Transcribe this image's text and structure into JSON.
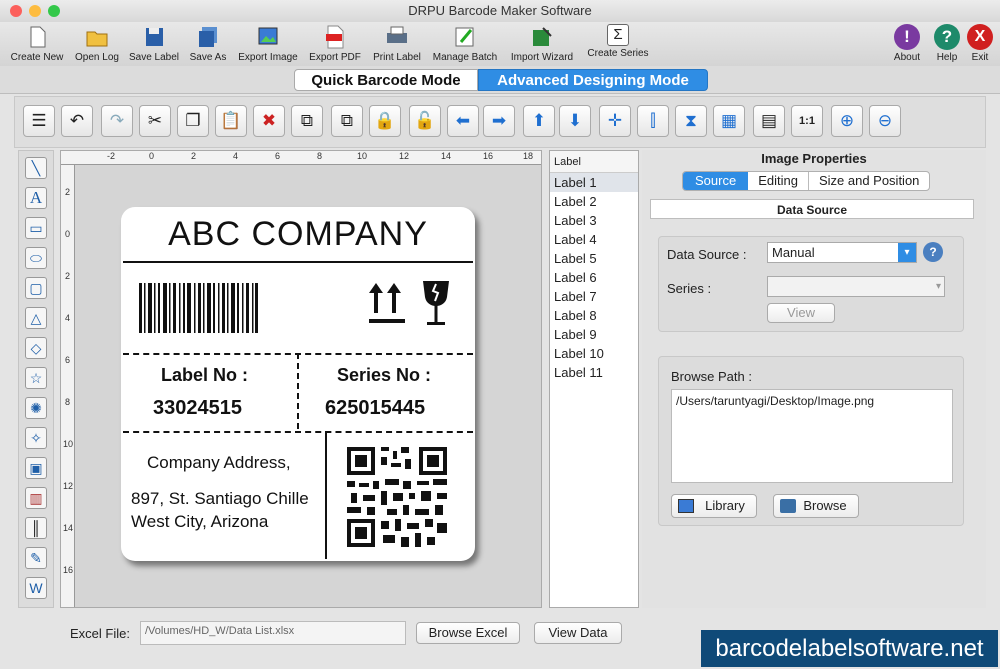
{
  "window": {
    "title": "DRPU Barcode Maker Software"
  },
  "toolbar": {
    "items": [
      {
        "label": "Create New",
        "icon": "document-icon"
      },
      {
        "label": "Open Log",
        "icon": "folder-icon"
      },
      {
        "label": "Save Label",
        "icon": "floppy-icon"
      },
      {
        "label": "Save As",
        "icon": "floppy-multi-icon"
      },
      {
        "label": "Export Image",
        "icon": "image-export-icon"
      },
      {
        "label": "Export PDF",
        "icon": "pdf-icon"
      },
      {
        "label": "Print Label",
        "icon": "printer-icon"
      },
      {
        "label": "Manage Batch",
        "icon": "batch-icon"
      },
      {
        "label": "Import Wizard",
        "icon": "wizard-icon"
      },
      {
        "label": "Create Series",
        "icon": "sigma-icon"
      },
      {
        "label": "About",
        "icon": "about-icon"
      },
      {
        "label": "Help",
        "icon": "help-icon"
      },
      {
        "label": "Exit",
        "icon": "exit-icon"
      }
    ]
  },
  "modes": {
    "quick": "Quick Barcode Mode",
    "advanced": "Advanced Designing Mode"
  },
  "ruler": {
    "h": [
      "-2",
      "0",
      "2",
      "4",
      "6",
      "8",
      "10",
      "12",
      "14",
      "16",
      "18"
    ],
    "v": [
      "2",
      "0",
      "2",
      "4",
      "6",
      "8",
      "10",
      "12",
      "14",
      "16"
    ]
  },
  "label": {
    "company": "ABC COMPANY",
    "label_no_title": "Label No :",
    "label_no": "33024515",
    "series_no_title": "Series No :",
    "series_no": "625015445",
    "address_title": "Company Address,",
    "address_line1": "897, St. Santiago Chille",
    "address_line2": "West City, Arizona"
  },
  "label_list": {
    "header": "Label",
    "items": [
      "Label 1",
      "Label 2",
      "Label 3",
      "Label 4",
      "Label 5",
      "Label 6",
      "Label 7",
      "Label 8",
      "Label 9",
      "Label 10",
      "Label 11"
    ]
  },
  "properties": {
    "title": "Image Properties",
    "tabs": [
      "Source",
      "Editing",
      "Size and Position"
    ],
    "section": "Data Source",
    "data_source_label": "Data Source :",
    "data_source_value": "Manual",
    "series_label": "Series :",
    "view_button": "View",
    "browse_path_label": "Browse Path :",
    "browse_path_value": "/Users/taruntyagi/Desktop/Image.png",
    "library_button": "Library",
    "browse_button": "Browse"
  },
  "bottom": {
    "excel_label": "Excel File:",
    "excel_path": "/Volumes/HD_W/Data List.xlsx",
    "browse_excel": "Browse Excel",
    "view_data": "View Data"
  },
  "watermark": "barcodelabelsoftware.net",
  "colors": {
    "accent": "#2f8de4",
    "watermark_bg": "#0f4a78"
  }
}
